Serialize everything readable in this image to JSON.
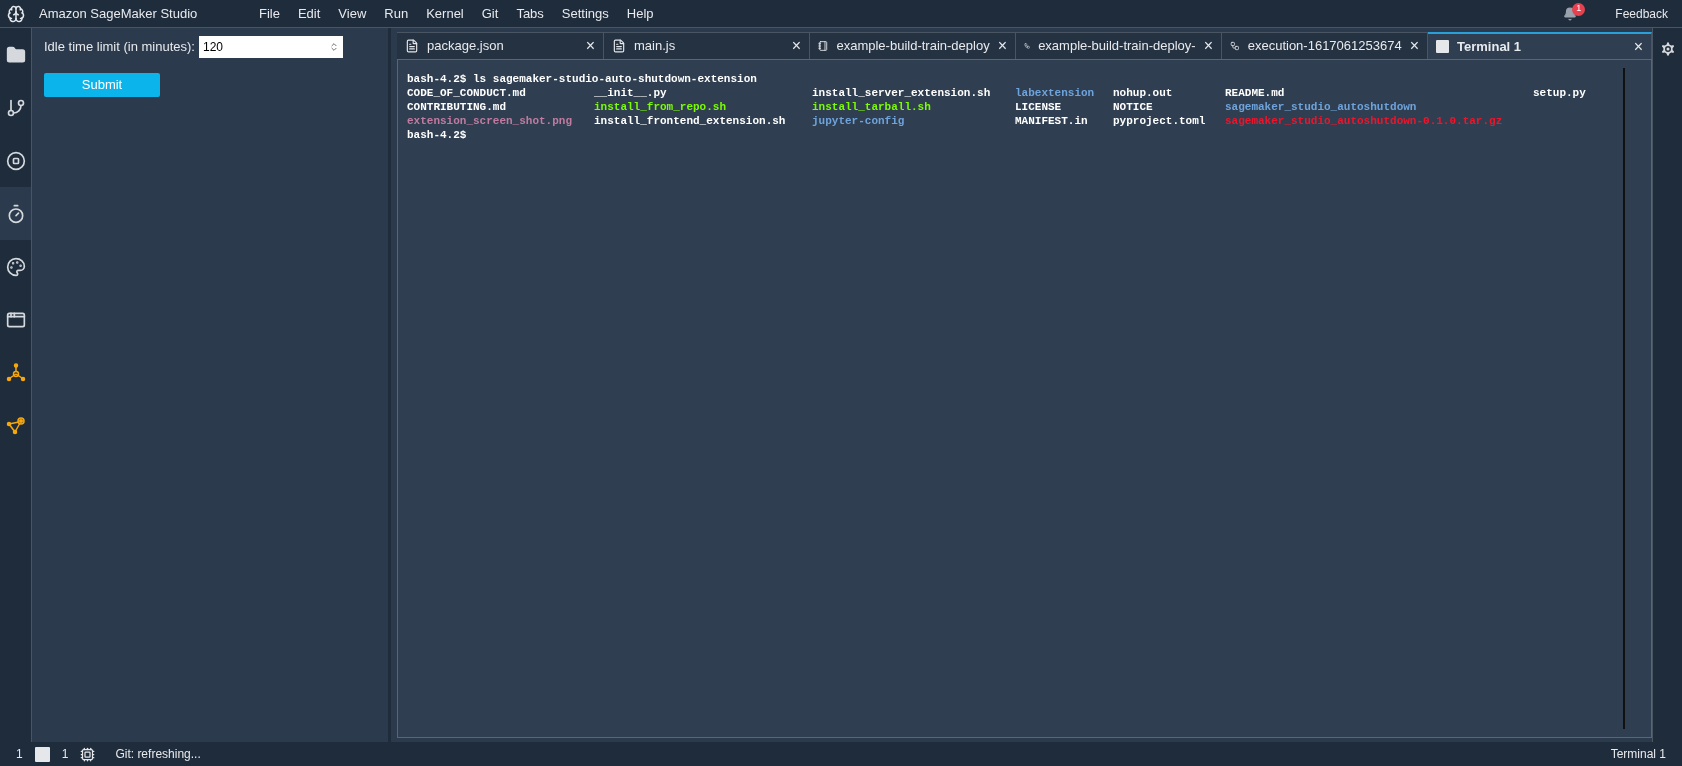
{
  "app": {
    "title": "Amazon SageMaker Studio"
  },
  "menu": [
    "File",
    "Edit",
    "View",
    "Run",
    "Kernel",
    "Git",
    "Tabs",
    "Settings",
    "Help"
  ],
  "notifications": {
    "count": "1"
  },
  "feedback": "Feedback",
  "activity_bar": [
    {
      "kind": "folder",
      "selected": false
    },
    {
      "kind": "git",
      "selected": false
    },
    {
      "kind": "stop",
      "selected": false
    },
    {
      "kind": "chip-clock",
      "selected": true
    },
    {
      "kind": "palette",
      "selected": false
    },
    {
      "kind": "window",
      "selected": false
    },
    {
      "kind": "hub",
      "selected": false
    },
    {
      "kind": "graph",
      "selected": false
    }
  ],
  "side_panel": {
    "field_label": "Idle time limit (in minutes):",
    "field_value": "120",
    "button": "Submit"
  },
  "tabs": [
    {
      "label": "package.json",
      "kind": "text",
      "selected": false,
      "close": "×"
    },
    {
      "label": "main.js",
      "kind": "text",
      "selected": false,
      "close": "×"
    },
    {
      "label": "example-build-train-deploy",
      "kind": "notebook",
      "selected": false,
      "close": "×"
    },
    {
      "label": "example-build-train-deploy-",
      "kind": "flow",
      "selected": false,
      "close": "×"
    },
    {
      "label": "execution-1617061253674",
      "kind": "flow",
      "selected": false,
      "close": "×"
    },
    {
      "label": "Terminal 1",
      "kind": "terminal",
      "selected": true,
      "close": "×"
    }
  ],
  "terminal": {
    "command": "bash-4.2$ ls sagemaker-studio-auto-shutdown-extension",
    "listing": [
      [
        {
          "text": "CODE_OF_CONDUCT.md",
          "color": "#ffffff"
        },
        {
          "text": "__init__.py",
          "color": "#ffffff"
        },
        {
          "text": "install_server_extension.sh",
          "color": "#ffffff"
        },
        {
          "text": "labextension",
          "color": "#6fa3dc"
        },
        {
          "text": "nohup.out",
          "color": "#ffffff"
        },
        {
          "text": "README.md",
          "color": "#ffffff"
        },
        {
          "text": "setup.py",
          "color": "#ffffff"
        }
      ],
      [
        {
          "text": "CONTRIBUTING.md",
          "color": "#ffffff"
        },
        {
          "text": "install_from_repo.sh",
          "color": "#7cfc00"
        },
        {
          "text": "install_tarball.sh",
          "color": "#7cfc00"
        },
        {
          "text": "LICENSE",
          "color": "#ffffff"
        },
        {
          "text": "NOTICE",
          "color": "#ffffff"
        },
        {
          "text": "sagemaker_studio_autoshutdown",
          "color": "#6fa3dc"
        }
      ],
      [
        {
          "text": "extension_screen_shot.png",
          "color": "#c27ba0"
        },
        {
          "text": "install_frontend_extension.sh",
          "color": "#ffffff"
        },
        {
          "text": "jupyter-config",
          "color": "#6fa3dc"
        },
        {
          "text": "MANIFEST.in",
          "color": "#ffffff"
        },
        {
          "text": "pyproject.toml",
          "color": "#ffffff"
        },
        {
          "text": "sagemaker_studio_autoshutdown-0.1.0.tar.gz",
          "color": "#f0142b"
        }
      ]
    ],
    "prompt": "bash-4.2$"
  },
  "status_bar": {
    "left_count": "1",
    "terminal_count": "1",
    "git_status": "Git: refreshing...",
    "right": "Terminal 1"
  }
}
